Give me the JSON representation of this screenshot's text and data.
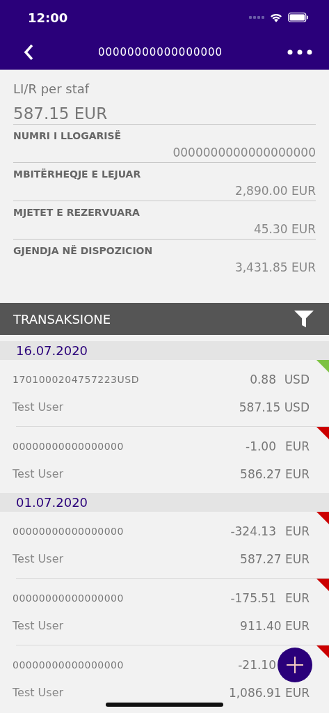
{
  "status_bar": {
    "time": "12:00"
  },
  "nav": {
    "title": "00000000000000000"
  },
  "account": {
    "type": "LI/R per staf",
    "balance": "587.15 EUR",
    "fields": [
      {
        "label": "NUMRI I LLOGARISË",
        "value": "0000000000000000000"
      },
      {
        "label": "MBITËRHEQJE E LEJUAR",
        "value": "2,890.00 EUR"
      },
      {
        "label": "MJETET E REZERVUARA",
        "value": "45.30 EUR"
      },
      {
        "label": "GJENDJA NË DISPOZICION",
        "value": "3,431.85 EUR"
      }
    ]
  },
  "transactions": {
    "title": "TRANSAKSIONE",
    "groups": [
      {
        "date": "16.07.2020",
        "items": [
          {
            "reference": "1701000204757223USD",
            "amount": "0.88",
            "currency": "USD",
            "name": "Test User",
            "balance": "587.15 USD",
            "color": "#7dc242"
          },
          {
            "reference": "00000000000000000",
            "amount": "-1.00",
            "currency": "EUR",
            "name": "Test User",
            "balance": "586.27 EUR",
            "color": "#cc0000"
          }
        ]
      },
      {
        "date": "01.07.2020",
        "items": [
          {
            "reference": "00000000000000000",
            "amount": "-324.13",
            "currency": "EUR",
            "name": "Test User",
            "balance": "587.27 EUR",
            "color": "#cc0000"
          },
          {
            "reference": "00000000000000000",
            "amount": "-175.51",
            "currency": "EUR",
            "name": "Test User",
            "balance": "911.40 EUR",
            "color": "#cc0000"
          },
          {
            "reference": "00000000000000000",
            "amount": "-21.10",
            "name": "Test User",
            "balance": "1,086.91 EUR",
            "color": "#cc0000"
          }
        ]
      }
    ]
  }
}
